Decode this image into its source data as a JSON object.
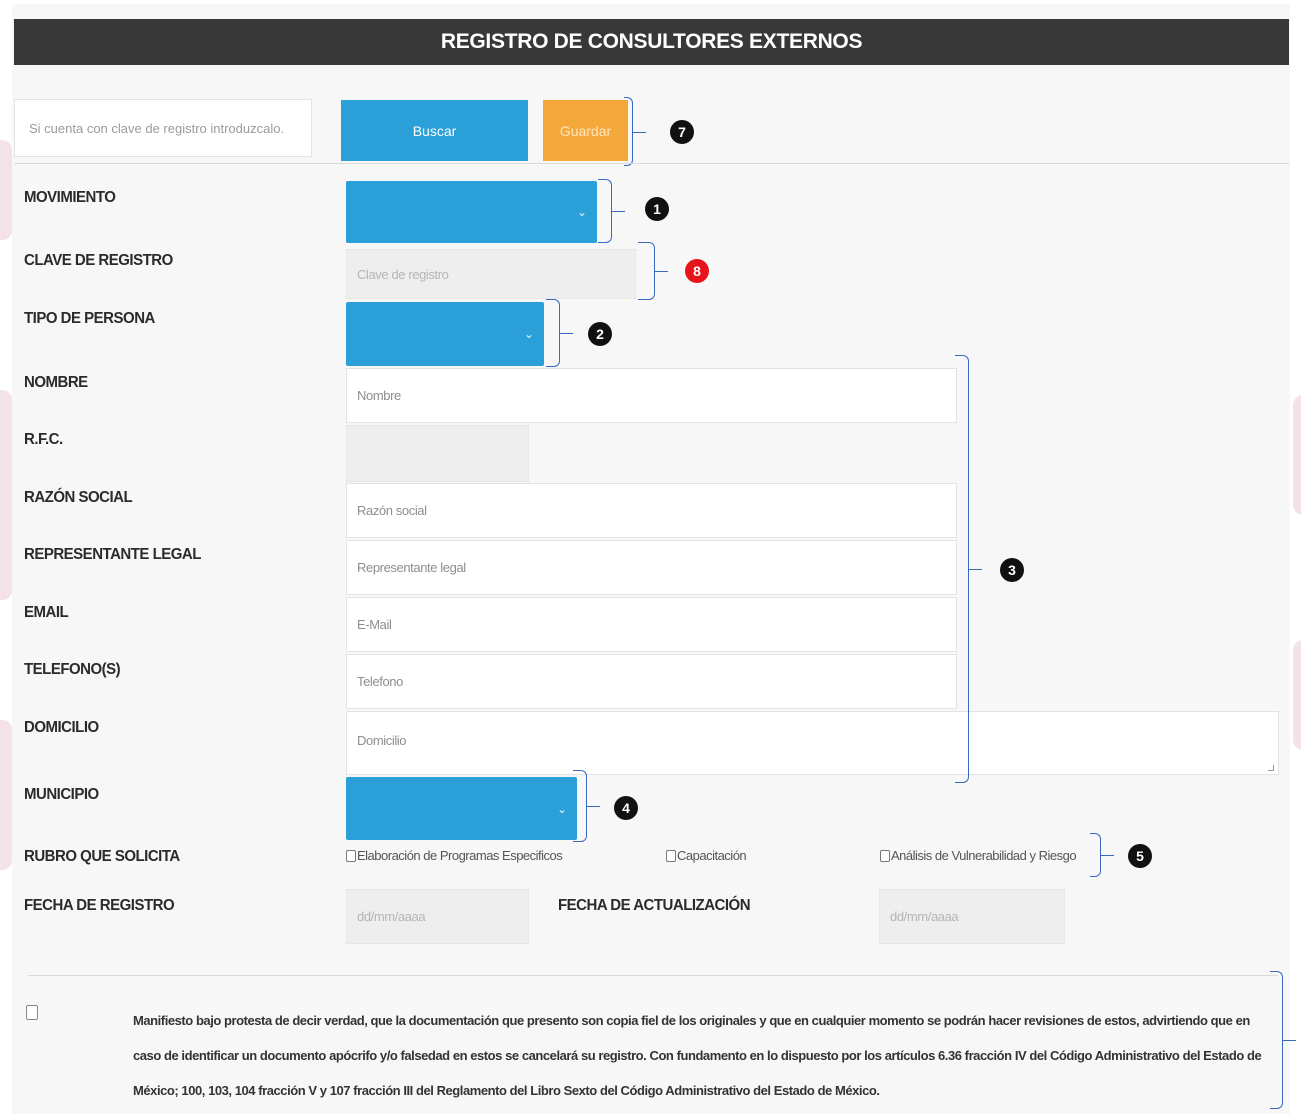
{
  "title": "REGISTRO DE CONSULTORES EXTERNOS",
  "toolbar": {
    "search_placeholder": "Si cuenta con clave de registro introduzcalo.",
    "search_label": "Buscar",
    "save_label": "Guardar"
  },
  "labels": {
    "movimiento": "MOVIMIENTO",
    "clave_registro": "CLAVE DE REGISTRO",
    "tipo_persona": "TIPO DE PERSONA",
    "nombre": "NOMBRE",
    "rfc": "R.F.C.",
    "razon_social": "RAZÓN SOCIAL",
    "representante_legal": "REPRESENTANTE LEGAL",
    "email": "EMAIL",
    "telefonos": "TELEFONO(S)",
    "domicilio": "DOMICILIO",
    "municipio": "MUNICIPIO",
    "rubro": "RUBRO QUE SOLICITA",
    "fecha_registro": "FECHA DE REGISTRO",
    "fecha_actualizacion": "FECHA DE ACTUALIZACIÓN"
  },
  "placeholders": {
    "clave_registro": "Clave de registro",
    "nombre": "Nombre",
    "rfc": "",
    "razon_social": "Razón social",
    "representante_legal": "Representante legal",
    "email": "E-Mail",
    "telefono": "Telefono",
    "domicilio": "Domicilio",
    "fecha_registro": "dd/mm/aaaa",
    "fecha_actualizacion": "dd/mm/aaaa"
  },
  "rubro_options": [
    "Elaboración de Programas Especificos",
    "Capacitación",
    "Análisis de Vulnerabilidad y Riesgo"
  ],
  "legal_text": "Manifiesto bajo protesta de decir verdad, que la documentación que presento son copia fiel de los originales y que en cualquier momento se podrán hacer revisiones de estos, advirtiendo que en caso de identificar un documento apócrifo y/o falsedad en estos se cancelará su registro. Con fundamento en lo dispuesto por los artículos 6.36 fracción IV del Código Administrativo del Estado de México; 100, 103, 104 fracción V y 107 fracción III del Reglamento del Libro Sexto del Código Administrativo del Estado de México.",
  "annotations": {
    "a1": "1",
    "a2": "2",
    "a3": "3",
    "a4": "4",
    "a5": "5",
    "a7": "7",
    "a8": "8"
  },
  "colors": {
    "title_bar": "#383838",
    "select_blue": "#2a9fd8",
    "save_orange": "#f5a83a",
    "bracket_blue": "#3b68c2",
    "badge_red": "#e8141b"
  },
  "icons": {
    "select_arrow": "⌄"
  }
}
